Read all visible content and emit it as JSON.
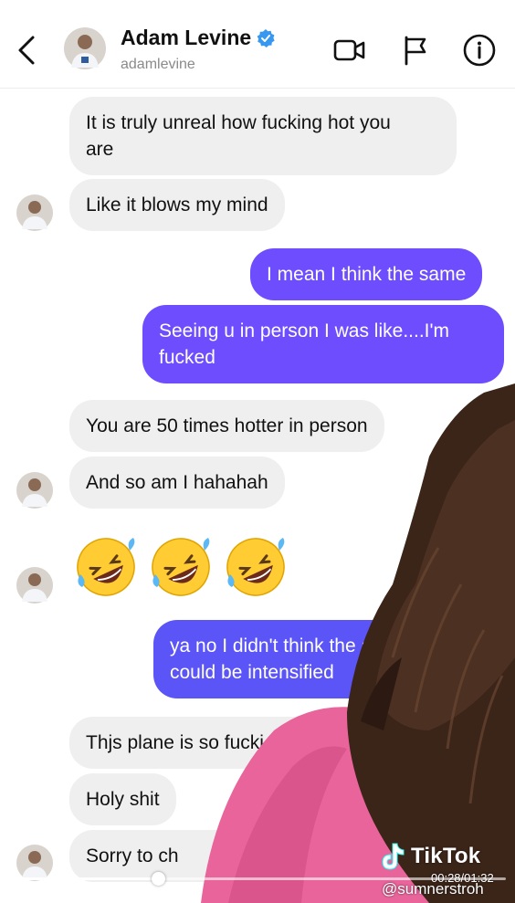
{
  "header": {
    "name": "Adam Levine",
    "username": "adamlevine",
    "icons": [
      "back-icon",
      "video-call-icon",
      "flag-icon",
      "info-icon"
    ]
  },
  "messages": [
    {
      "from": "them",
      "text": [
        "It is truly unreal how fucking hot you",
        "are"
      ]
    },
    {
      "from": "them",
      "text": [
        "Like it blows my mind"
      ]
    },
    {
      "from": "me",
      "text": [
        "I mean I think the same"
      ]
    },
    {
      "from": "me",
      "text": [
        "Seeing u in person I was like....I'm",
        "fucked"
      ]
    },
    {
      "from": "them",
      "text": [
        "You are 50 times hotter in person"
      ]
    },
    {
      "from": "them",
      "text": [
        "And so am I hahahah"
      ]
    },
    {
      "from": "them",
      "emoji": [
        "rolling-on-floor-laughing",
        "rolling-on-floor-laughing",
        "rolling-on-floor-laughing"
      ]
    },
    {
      "from": "me",
      "text": [
        "ya no I didn't think the at",
        "could be intensified"
      ]
    },
    {
      "from": "them",
      "text": [
        "Thjs plane is so fucki"
      ]
    },
    {
      "from": "them",
      "text": [
        "Holy shit"
      ]
    },
    {
      "from": "them",
      "text": [
        "Sorry to ch"
      ]
    }
  ],
  "overlay": {
    "brand": "TikTok",
    "handle": "@sumnerstroh",
    "time": "00:28/01:32",
    "progress": 0.3
  },
  "colors": {
    "incoming": "#efefef",
    "outgoing": "#6e4dff",
    "outgoing_blue": "#5b55f7",
    "verified": "#3897f0"
  }
}
